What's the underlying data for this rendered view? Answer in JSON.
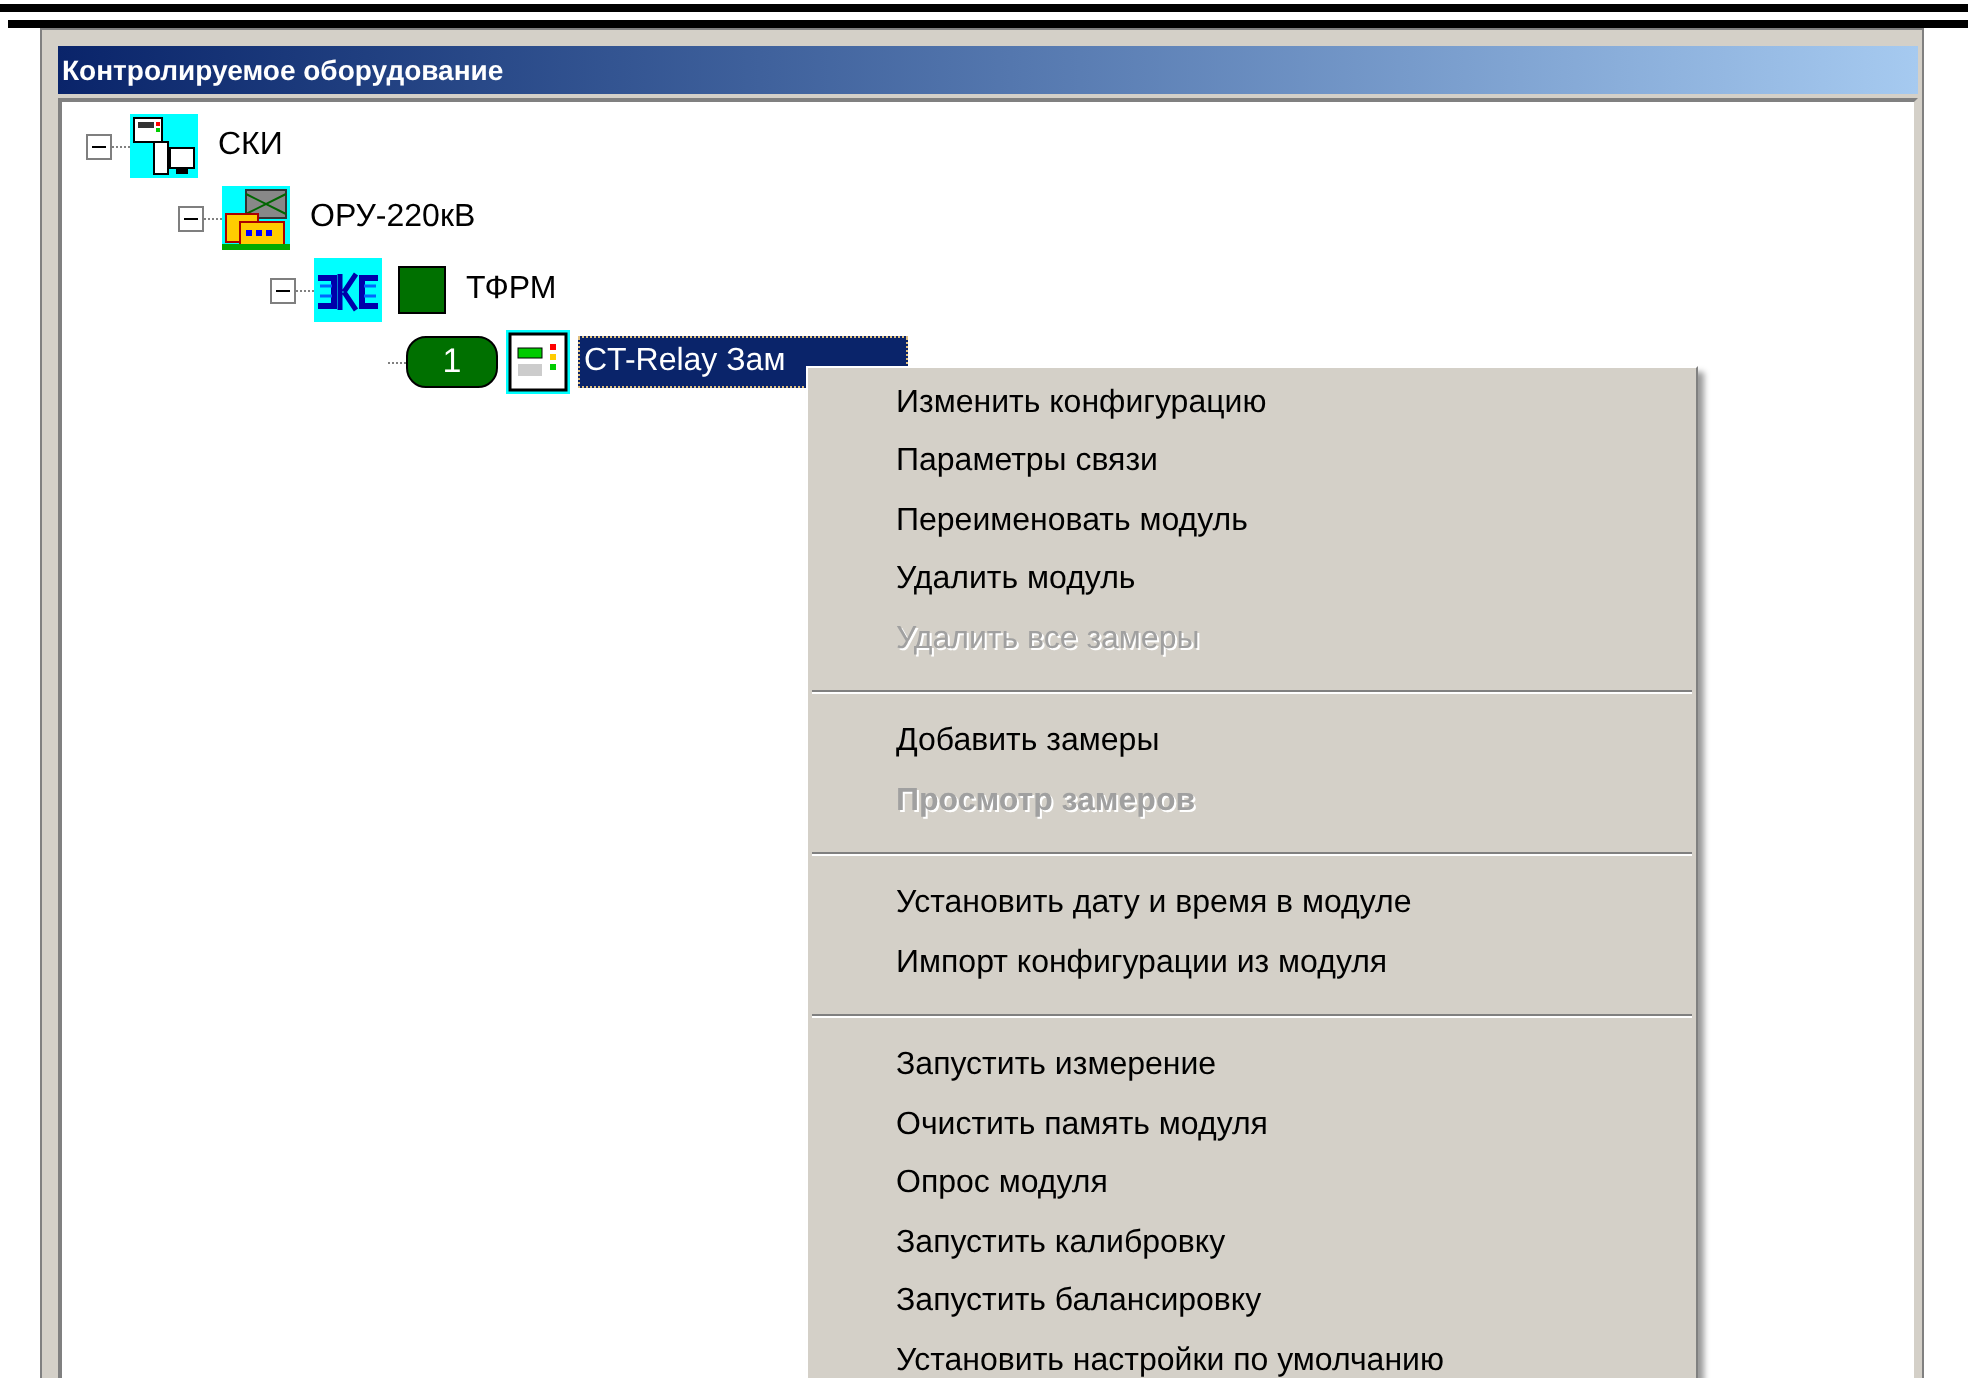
{
  "panel": {
    "title": "Контролируемое оборудование"
  },
  "tree": [
    {
      "label": "СКИ",
      "kind": "station",
      "expanded": true,
      "selected": false,
      "children": [
        {
          "label": "ОРУ-220кВ",
          "kind": "substation",
          "expanded": true,
          "selected": false,
          "children": [
            {
              "label": "ТФРМ",
              "kind": "transformer",
              "expanded": true,
              "selected": false,
              "color": "#007000",
              "children": [
                {
                  "label": "CT-Relay Зам",
                  "kind": "module",
                  "badge": "1",
                  "selected": true
                }
              ]
            }
          ]
        }
      ]
    }
  ],
  "context_menu": [
    {
      "kind": "item",
      "label": "Изменить конфигурацию",
      "disabled": false
    },
    {
      "kind": "item",
      "label": "Параметры связи",
      "disabled": false
    },
    {
      "kind": "item",
      "label": "Переименовать модуль",
      "disabled": false
    },
    {
      "kind": "item",
      "label": "Удалить модуль",
      "disabled": false
    },
    {
      "kind": "item",
      "label": "Удалить все замеры",
      "disabled": true
    },
    {
      "kind": "separator"
    },
    {
      "kind": "item",
      "label": "Добавить замеры",
      "disabled": false
    },
    {
      "kind": "item",
      "label": "Просмотр замеров",
      "disabled": true,
      "default": true
    },
    {
      "kind": "separator"
    },
    {
      "kind": "item",
      "label": "Установить дату и время в модуле",
      "disabled": false
    },
    {
      "kind": "item",
      "label": "Импорт конфигурации из модуля",
      "disabled": false
    },
    {
      "kind": "separator"
    },
    {
      "kind": "item",
      "label": "Запустить измерение",
      "disabled": false
    },
    {
      "kind": "item",
      "label": "Очистить память модуля",
      "disabled": false
    },
    {
      "kind": "item",
      "label": "Опрос модуля",
      "disabled": false
    },
    {
      "kind": "item",
      "label": "Запустить калибровку",
      "disabled": false
    },
    {
      "kind": "item",
      "label": "Запустить балансировку",
      "disabled": false
    },
    {
      "kind": "item",
      "label": "Установить настройки по умолчанию",
      "disabled": false
    }
  ]
}
